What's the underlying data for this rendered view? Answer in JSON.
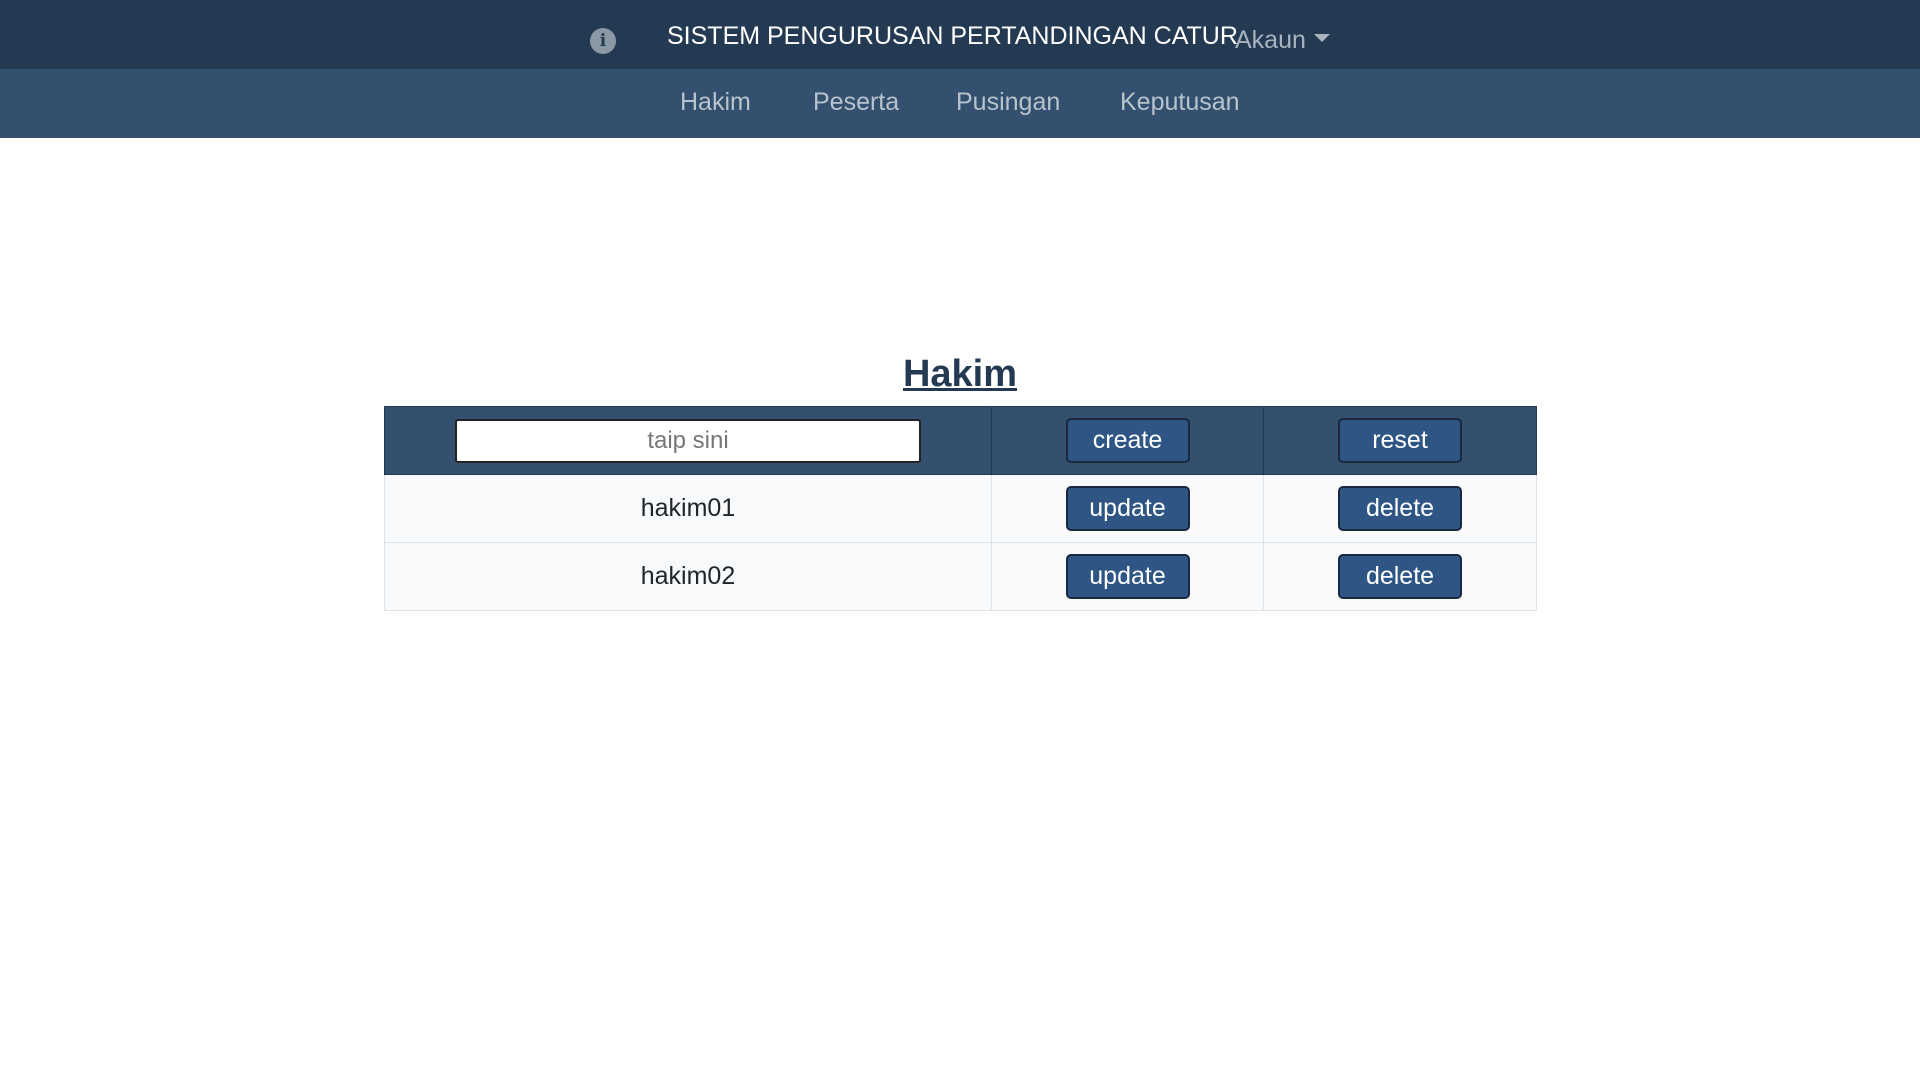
{
  "header": {
    "info_icon": "info-circle-icon",
    "title": "SISTEM PENGURUSAN PERTANDINGAN CATUR",
    "account_label": "Akaun",
    "account_icon": "caret-down-icon"
  },
  "nav": {
    "items": [
      {
        "label": "Hakim"
      },
      {
        "label": "Peserta"
      },
      {
        "label": "Pusingan"
      },
      {
        "label": "Keputusan"
      }
    ]
  },
  "main": {
    "title": "Hakim",
    "search": {
      "placeholder": "taip sini",
      "value": ""
    },
    "create_label": "create",
    "reset_label": "reset",
    "rows": [
      {
        "name": "hakim01",
        "update_label": "update",
        "delete_label": "delete"
      },
      {
        "name": "hakim02",
        "update_label": "update",
        "delete_label": "delete"
      }
    ]
  },
  "colors": {
    "header_bg": "#243a52",
    "subnav_bg": "#33506e",
    "button_bg": "#2e5584",
    "title_color": "#243a52"
  }
}
